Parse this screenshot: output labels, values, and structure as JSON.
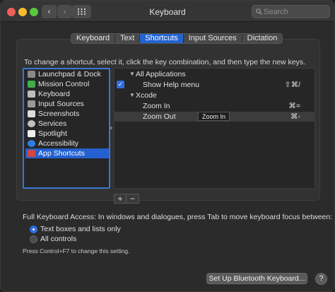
{
  "window": {
    "title": "Keyboard",
    "search_placeholder": "Search",
    "back_glyph": "‹",
    "forward_glyph": "›"
  },
  "tabs": [
    {
      "label": "Keyboard",
      "active": false
    },
    {
      "label": "Text",
      "active": false
    },
    {
      "label": "Shortcuts",
      "active": true
    },
    {
      "label": "Input Sources",
      "active": false
    },
    {
      "label": "Dictation",
      "active": false
    }
  ],
  "instructions": "To change a shortcut, select it, click the key combination, and then type the new keys.",
  "categories": [
    {
      "label": "Launchpad & Dock",
      "icon": "launchpad-icon",
      "color": "#8a8a8a"
    },
    {
      "label": "Mission Control",
      "icon": "mission-control-icon",
      "color": "#3fae4a"
    },
    {
      "label": "Keyboard",
      "icon": "keyboard-icon",
      "color": "#bdbdbd"
    },
    {
      "label": "Input Sources",
      "icon": "input-sources-icon",
      "color": "#9a9a9a"
    },
    {
      "label": "Screenshots",
      "icon": "screenshots-icon",
      "color": "#dcdcdc"
    },
    {
      "label": "Services",
      "icon": "gear-icon",
      "color": "#c0c0c0"
    },
    {
      "label": "Spotlight",
      "icon": "spotlight-icon",
      "color": "#efefef"
    },
    {
      "label": "Accessibility",
      "icon": "accessibility-icon",
      "color": "#2f7de1"
    },
    {
      "label": "App Shortcuts",
      "icon": "app-shortcuts-icon",
      "color": "#d7463c",
      "selected": true
    }
  ],
  "shortcuts": {
    "all_apps_label": "All Applications",
    "show_help_label": "Show Help menu",
    "show_help_key": "⇧⌘/",
    "xcode_label": "Xcode",
    "zoom_in_label": "Zoom In",
    "zoom_in_key": "⌘=",
    "zoom_out_label": "Zoom Out",
    "zoom_out_key": "⌘-",
    "tooltip": "Zoom In",
    "checkmark": "✓",
    "expanded_glyph": "▼"
  },
  "add_label": "+",
  "remove_label": "−",
  "full_keyboard_access": "Full Keyboard Access: In windows and dialogues, press Tab to move keyboard focus between:",
  "radio_options": [
    {
      "label": "Text boxes and lists only",
      "selected": true
    },
    {
      "label": "All controls",
      "selected": false
    }
  ],
  "hint": "Press Control+F7 to change this setting.",
  "bluetooth_button": "Set Up Bluetooth Keyboard...",
  "help_label": "?"
}
